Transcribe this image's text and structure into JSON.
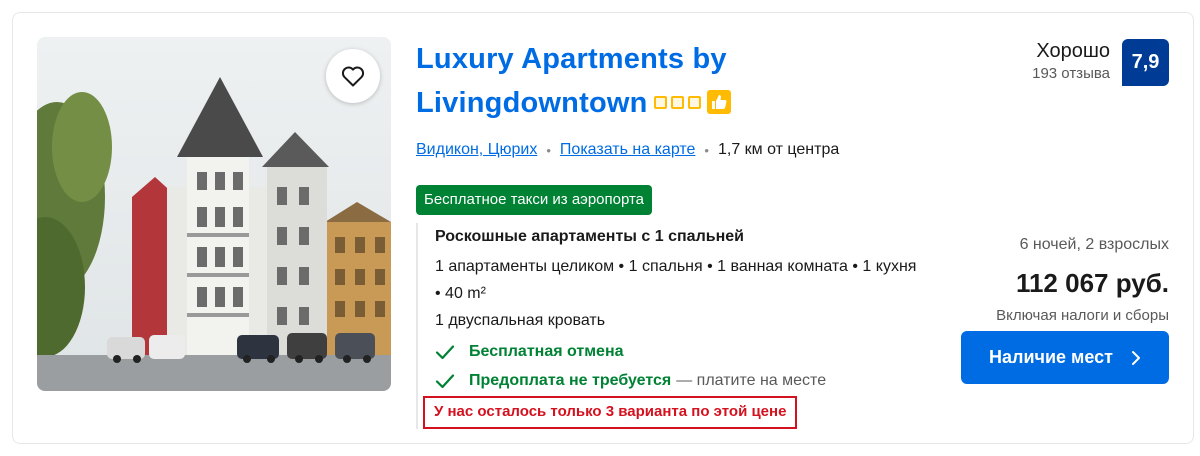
{
  "property": {
    "name": "Luxury Apartments by Livingdowntown",
    "stars": 3,
    "favorite_icon": "heart-outline-icon",
    "location": {
      "area": "Видикон, Цюрих",
      "map_link": "Показать на карте",
      "distance": "1,7 км от центра"
    },
    "badge": "Бесплатное такси из аэропорта"
  },
  "review": {
    "label": "Хорошо",
    "count_text": "193 отзыва",
    "score": "7,9"
  },
  "room": {
    "title": "Роскошные апартаменты с 1 спальней",
    "description": "1 апартаменты целиком • 1 спальня • 1 ванная комната • 1 кухня • 40 m²",
    "bed": "1 двуспальная кровать",
    "perks": [
      {
        "label": "Бесплатная отмена",
        "note": ""
      },
      {
        "label": "Предоплата не требуется",
        "note": "— платите на месте"
      }
    ],
    "scarcity": "У нас осталось только 3 варианта по этой цене"
  },
  "price": {
    "stay": "6 ночей, 2 взрослых",
    "amount": "112 067 руб.",
    "taxes": "Включая налоги и сборы"
  },
  "cta": {
    "label": "Наличие мест"
  },
  "colors": {
    "link": "#006ce4",
    "score_bg": "#003b95",
    "green": "#008234",
    "alert": "#d4111e",
    "stars": "#febb02"
  }
}
